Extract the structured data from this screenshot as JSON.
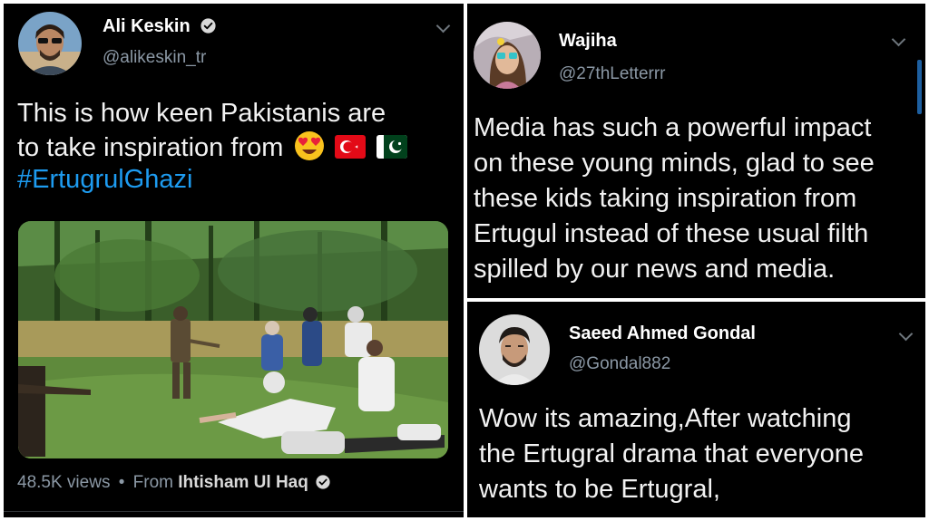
{
  "tweet1": {
    "name": "Ali Keskin",
    "handle": "@alikeskin_tr",
    "text_line1": "This is how keen Pakistanis are",
    "text_line2": "to take inspiration from",
    "hashtag": "#ErtugrulGhazi",
    "views": "48.5K views",
    "separator": "•",
    "from_label": "From",
    "from_user": "Ihtisham Ul Haq"
  },
  "tweet2": {
    "name": "Wajiha",
    "handle": "@27thLetterrr",
    "lines": [
      "Media has such a powerful impact",
      "on these young minds, glad to see",
      "these kids taking inspiration from",
      "Ertugul instead of these usual filth",
      "spilled by our news and media."
    ]
  },
  "tweet3": {
    "name": "Saeed Ahmed Gondal",
    "handle": "@Gondal882",
    "lines": [
      "Wow its amazing,After watching",
      "the Ertugral drama that everyone",
      "wants to be Ertugral,"
    ]
  },
  "colors": {
    "background": "#000000",
    "hashtag": "#1d9bf0",
    "handle": "#8b98a5",
    "verified": "#d9d9d9"
  }
}
